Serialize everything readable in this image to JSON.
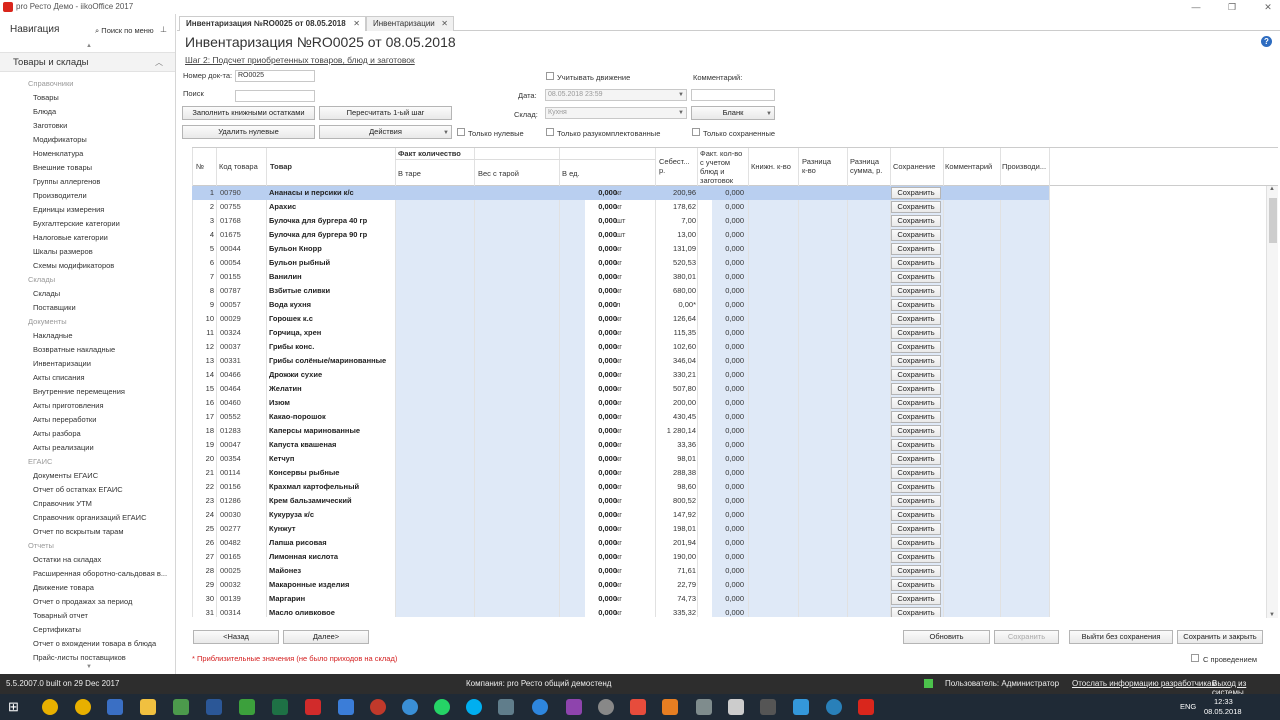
{
  "window": {
    "title": "pro Ресто Демо - iikoOffice 2017"
  },
  "nav": {
    "header": "Навигация",
    "search": "Поиск по меню",
    "section": "Товары и склады",
    "items": [
      {
        "group": true,
        "label": "Справочники"
      },
      {
        "label": "Товары"
      },
      {
        "label": "Блюда"
      },
      {
        "label": "Заготовки"
      },
      {
        "label": "Модификаторы"
      },
      {
        "label": "Номенклатура"
      },
      {
        "label": "Внешние товары"
      },
      {
        "label": "Группы аллергенов"
      },
      {
        "label": "Производители"
      },
      {
        "label": "Единицы измерения"
      },
      {
        "label": "Бухгалтерские категории"
      },
      {
        "label": "Налоговые категории"
      },
      {
        "label": "Шкалы размеров"
      },
      {
        "label": "Схемы модификаторов"
      },
      {
        "group": true,
        "label": "Склады"
      },
      {
        "label": "Склады"
      },
      {
        "label": "Поставщики"
      },
      {
        "group": true,
        "label": "Документы"
      },
      {
        "label": "Накладные"
      },
      {
        "label": "Возвратные накладные"
      },
      {
        "label": "Инвентаризации"
      },
      {
        "label": "Акты списания"
      },
      {
        "label": "Внутренние перемещения"
      },
      {
        "label": "Акты приготовления"
      },
      {
        "label": "Акты переработки"
      },
      {
        "label": "Акты разбора"
      },
      {
        "label": "Акты реализации"
      },
      {
        "group": true,
        "label": "ЕГАИС"
      },
      {
        "label": "Документы ЕГАИС"
      },
      {
        "label": "Отчет об остатках ЕГАИС"
      },
      {
        "label": "Справочник УТМ"
      },
      {
        "label": "Справочник организаций ЕГАИС"
      },
      {
        "label": "Отчет по вскрытым тарам"
      },
      {
        "group": true,
        "label": "Отчеты"
      },
      {
        "label": "Остатки на складах"
      },
      {
        "label": "Расширенная оборотно-сальдовая в..."
      },
      {
        "label": "Движение товара"
      },
      {
        "label": "Отчет о продажах за период"
      },
      {
        "label": "Товарный отчет"
      },
      {
        "label": "Сертификаты"
      },
      {
        "label": "Отчет о вхождении товара в блюда"
      },
      {
        "label": "Прайс-листы поставщиков"
      }
    ]
  },
  "tabs": [
    {
      "label": "Инвентаризация №RO0025 от 08.05.2018"
    },
    {
      "label": "Инвентаризации"
    }
  ],
  "page": {
    "title": "Инвентаризация №RO0025 от 08.05.2018",
    "step": "Шаг 2: Подсчет приобретенных товаров, блюд и заготовок"
  },
  "form": {
    "doc_num_label": "Номер док-та:",
    "doc_num": "RO0025",
    "search_label": "Поиск",
    "consider_movement": "Учитывать движение",
    "comment_label": "Комментарий:",
    "date_label": "Дата:",
    "date": "08.05.2018 23:59",
    "store_label": "Склад:",
    "store": "Кухня",
    "blank": "Бланк",
    "fill_btn": "Заполнить книжными остатками",
    "recalc_btn": "Пересчитать 1-ый шаг",
    "delete_zero_btn": "Удалить нулевые",
    "actions_btn": "Действия",
    "only_zero": "Только нулевые",
    "only_incomplete": "Только разукомплектованные",
    "only_saved": "Только сохраненные"
  },
  "grid": {
    "headers": {
      "num": "№",
      "code": "Код товара",
      "name": "Товар",
      "fact_qty": "Факт количество",
      "in_tare": "В таре",
      "weight_tare": "Вес с тарой",
      "in_units": "В ед.",
      "cost": "Себест... р.",
      "fact_incl": "Факт. кол-во с учетом блюд и заготовок",
      "book_qty": "Книжн. к-во",
      "diff_qty": "Разница к-во",
      "diff_sum": "Разница сумма, р.",
      "save": "Сохранение",
      "comment": "Комментарий",
      "producer": "Производи..."
    },
    "save_label": "Сохранить",
    "rows": [
      {
        "n": "1",
        "code": "00790",
        "name": "Ананасы и персики к/с",
        "qty": "0,000",
        "unit": "кг",
        "cost": "200,96",
        "fact": "0,000"
      },
      {
        "n": "2",
        "code": "00755",
        "name": "Арахис",
        "qty": "0,000",
        "unit": "кг",
        "cost": "178,62",
        "fact": "0,000"
      },
      {
        "n": "3",
        "code": "01768",
        "name": "Булочка для бургера 40 гр",
        "qty": "0,000",
        "unit": "шт",
        "cost": "7,00",
        "fact": "0,000"
      },
      {
        "n": "4",
        "code": "01675",
        "name": "Булочка для бургера 90 гр",
        "qty": "0,000",
        "unit": "шт",
        "cost": "13,00",
        "fact": "0,000"
      },
      {
        "n": "5",
        "code": "00044",
        "name": "Бульон Кнорр",
        "qty": "0,000",
        "unit": "кг",
        "cost": "131,09",
        "fact": "0,000"
      },
      {
        "n": "6",
        "code": "00054",
        "name": "Бульон рыбный",
        "qty": "0,000",
        "unit": "кг",
        "cost": "520,53",
        "fact": "0,000"
      },
      {
        "n": "7",
        "code": "00155",
        "name": "Ванилин",
        "qty": "0,000",
        "unit": "кг",
        "cost": "380,01",
        "fact": "0,000"
      },
      {
        "n": "8",
        "code": "00787",
        "name": "Взбитые сливки",
        "qty": "0,000",
        "unit": "кг",
        "cost": "680,00",
        "fact": "0,000"
      },
      {
        "n": "9",
        "code": "00057",
        "name": "Вода кухня",
        "qty": "0,000",
        "unit": "л",
        "cost": "0,00*",
        "fact": "0,000"
      },
      {
        "n": "10",
        "code": "00029",
        "name": "Горошек к.с",
        "qty": "0,000",
        "unit": "кг",
        "cost": "126,64",
        "fact": "0,000"
      },
      {
        "n": "11",
        "code": "00324",
        "name": "Горчица, хрен",
        "qty": "0,000",
        "unit": "кг",
        "cost": "115,35",
        "fact": "0,000"
      },
      {
        "n": "12",
        "code": "00037",
        "name": "Грибы конс.",
        "qty": "0,000",
        "unit": "кг",
        "cost": "102,60",
        "fact": "0,000"
      },
      {
        "n": "13",
        "code": "00331",
        "name": "Грибы солёные/маринованные",
        "qty": "0,000",
        "unit": "кг",
        "cost": "346,04",
        "fact": "0,000"
      },
      {
        "n": "14",
        "code": "00466",
        "name": "Дрожжи сухие",
        "qty": "0,000",
        "unit": "кг",
        "cost": "330,21",
        "fact": "0,000"
      },
      {
        "n": "15",
        "code": "00464",
        "name": "Желатин",
        "qty": "0,000",
        "unit": "кг",
        "cost": "507,80",
        "fact": "0,000"
      },
      {
        "n": "16",
        "code": "00460",
        "name": "Изюм",
        "qty": "0,000",
        "unit": "кг",
        "cost": "200,00",
        "fact": "0,000"
      },
      {
        "n": "17",
        "code": "00552",
        "name": "Какао-порошок",
        "qty": "0,000",
        "unit": "кг",
        "cost": "430,45",
        "fact": "0,000"
      },
      {
        "n": "18",
        "code": "01283",
        "name": "Каперсы маринованные",
        "qty": "0,000",
        "unit": "кг",
        "cost": "1 280,14",
        "fact": "0,000"
      },
      {
        "n": "19",
        "code": "00047",
        "name": "Капуста квашеная",
        "qty": "0,000",
        "unit": "кг",
        "cost": "33,36",
        "fact": "0,000"
      },
      {
        "n": "20",
        "code": "00354",
        "name": "Кетчуп",
        "qty": "0,000",
        "unit": "кг",
        "cost": "98,01",
        "fact": "0,000"
      },
      {
        "n": "21",
        "code": "00114",
        "name": "Консервы рыбные",
        "qty": "0,000",
        "unit": "кг",
        "cost": "288,38",
        "fact": "0,000"
      },
      {
        "n": "22",
        "code": "00156",
        "name": "Крахмал картофельный",
        "qty": "0,000",
        "unit": "кг",
        "cost": "98,60",
        "fact": "0,000"
      },
      {
        "n": "23",
        "code": "01286",
        "name": "Крем бальзамический",
        "qty": "0,000",
        "unit": "кг",
        "cost": "800,52",
        "fact": "0,000"
      },
      {
        "n": "24",
        "code": "00030",
        "name": "Кукуруза к/с",
        "qty": "0,000",
        "unit": "кг",
        "cost": "147,92",
        "fact": "0,000"
      },
      {
        "n": "25",
        "code": "00277",
        "name": "Кунжут",
        "qty": "0,000",
        "unit": "кг",
        "cost": "198,01",
        "fact": "0,000"
      },
      {
        "n": "26",
        "code": "00482",
        "name": "Лапша рисовая",
        "qty": "0,000",
        "unit": "кг",
        "cost": "201,94",
        "fact": "0,000"
      },
      {
        "n": "27",
        "code": "00165",
        "name": "Лимонная кислота",
        "qty": "0,000",
        "unit": "кг",
        "cost": "190,00",
        "fact": "0,000"
      },
      {
        "n": "28",
        "code": "00025",
        "name": "Майонез",
        "qty": "0,000",
        "unit": "кг",
        "cost": "71,61",
        "fact": "0,000"
      },
      {
        "n": "29",
        "code": "00032",
        "name": "Макаронные изделия",
        "qty": "0,000",
        "unit": "кг",
        "cost": "22,79",
        "fact": "0,000"
      },
      {
        "n": "30",
        "code": "00139",
        "name": "Маргарин",
        "qty": "0,000",
        "unit": "кг",
        "cost": "74,73",
        "fact": "0,000"
      },
      {
        "n": "31",
        "code": "00314",
        "name": "Масло оливковое",
        "qty": "0,000",
        "unit": "кг",
        "cost": "335,32",
        "fact": "0,000"
      }
    ]
  },
  "footer": {
    "back": "<Назад",
    "next": "Далее>",
    "note": "* Приблизительные значения (не было приходов на склад)",
    "refresh": "Обновить",
    "save": "Сохранить",
    "exit_no_save": "Выйти без сохранения",
    "save_close": "Сохранить и закрыть",
    "with_posting": "С проведением"
  },
  "status": {
    "build": "5.5.2007.0 built on 29 Dec 2017",
    "company": "Компания: pro Ресто общий демостенд",
    "user": "Пользователь: Администратор",
    "send_info": "Отослать информацию разработчикам",
    "exit": "Выход из системы"
  },
  "tray": {
    "lang": "ENG",
    "time": "12:33",
    "date": "08.05.2018"
  },
  "colors": {
    "selected_row": "#b9cff0",
    "blue_col": "#dfe9f7",
    "note_red": "#d42020"
  }
}
